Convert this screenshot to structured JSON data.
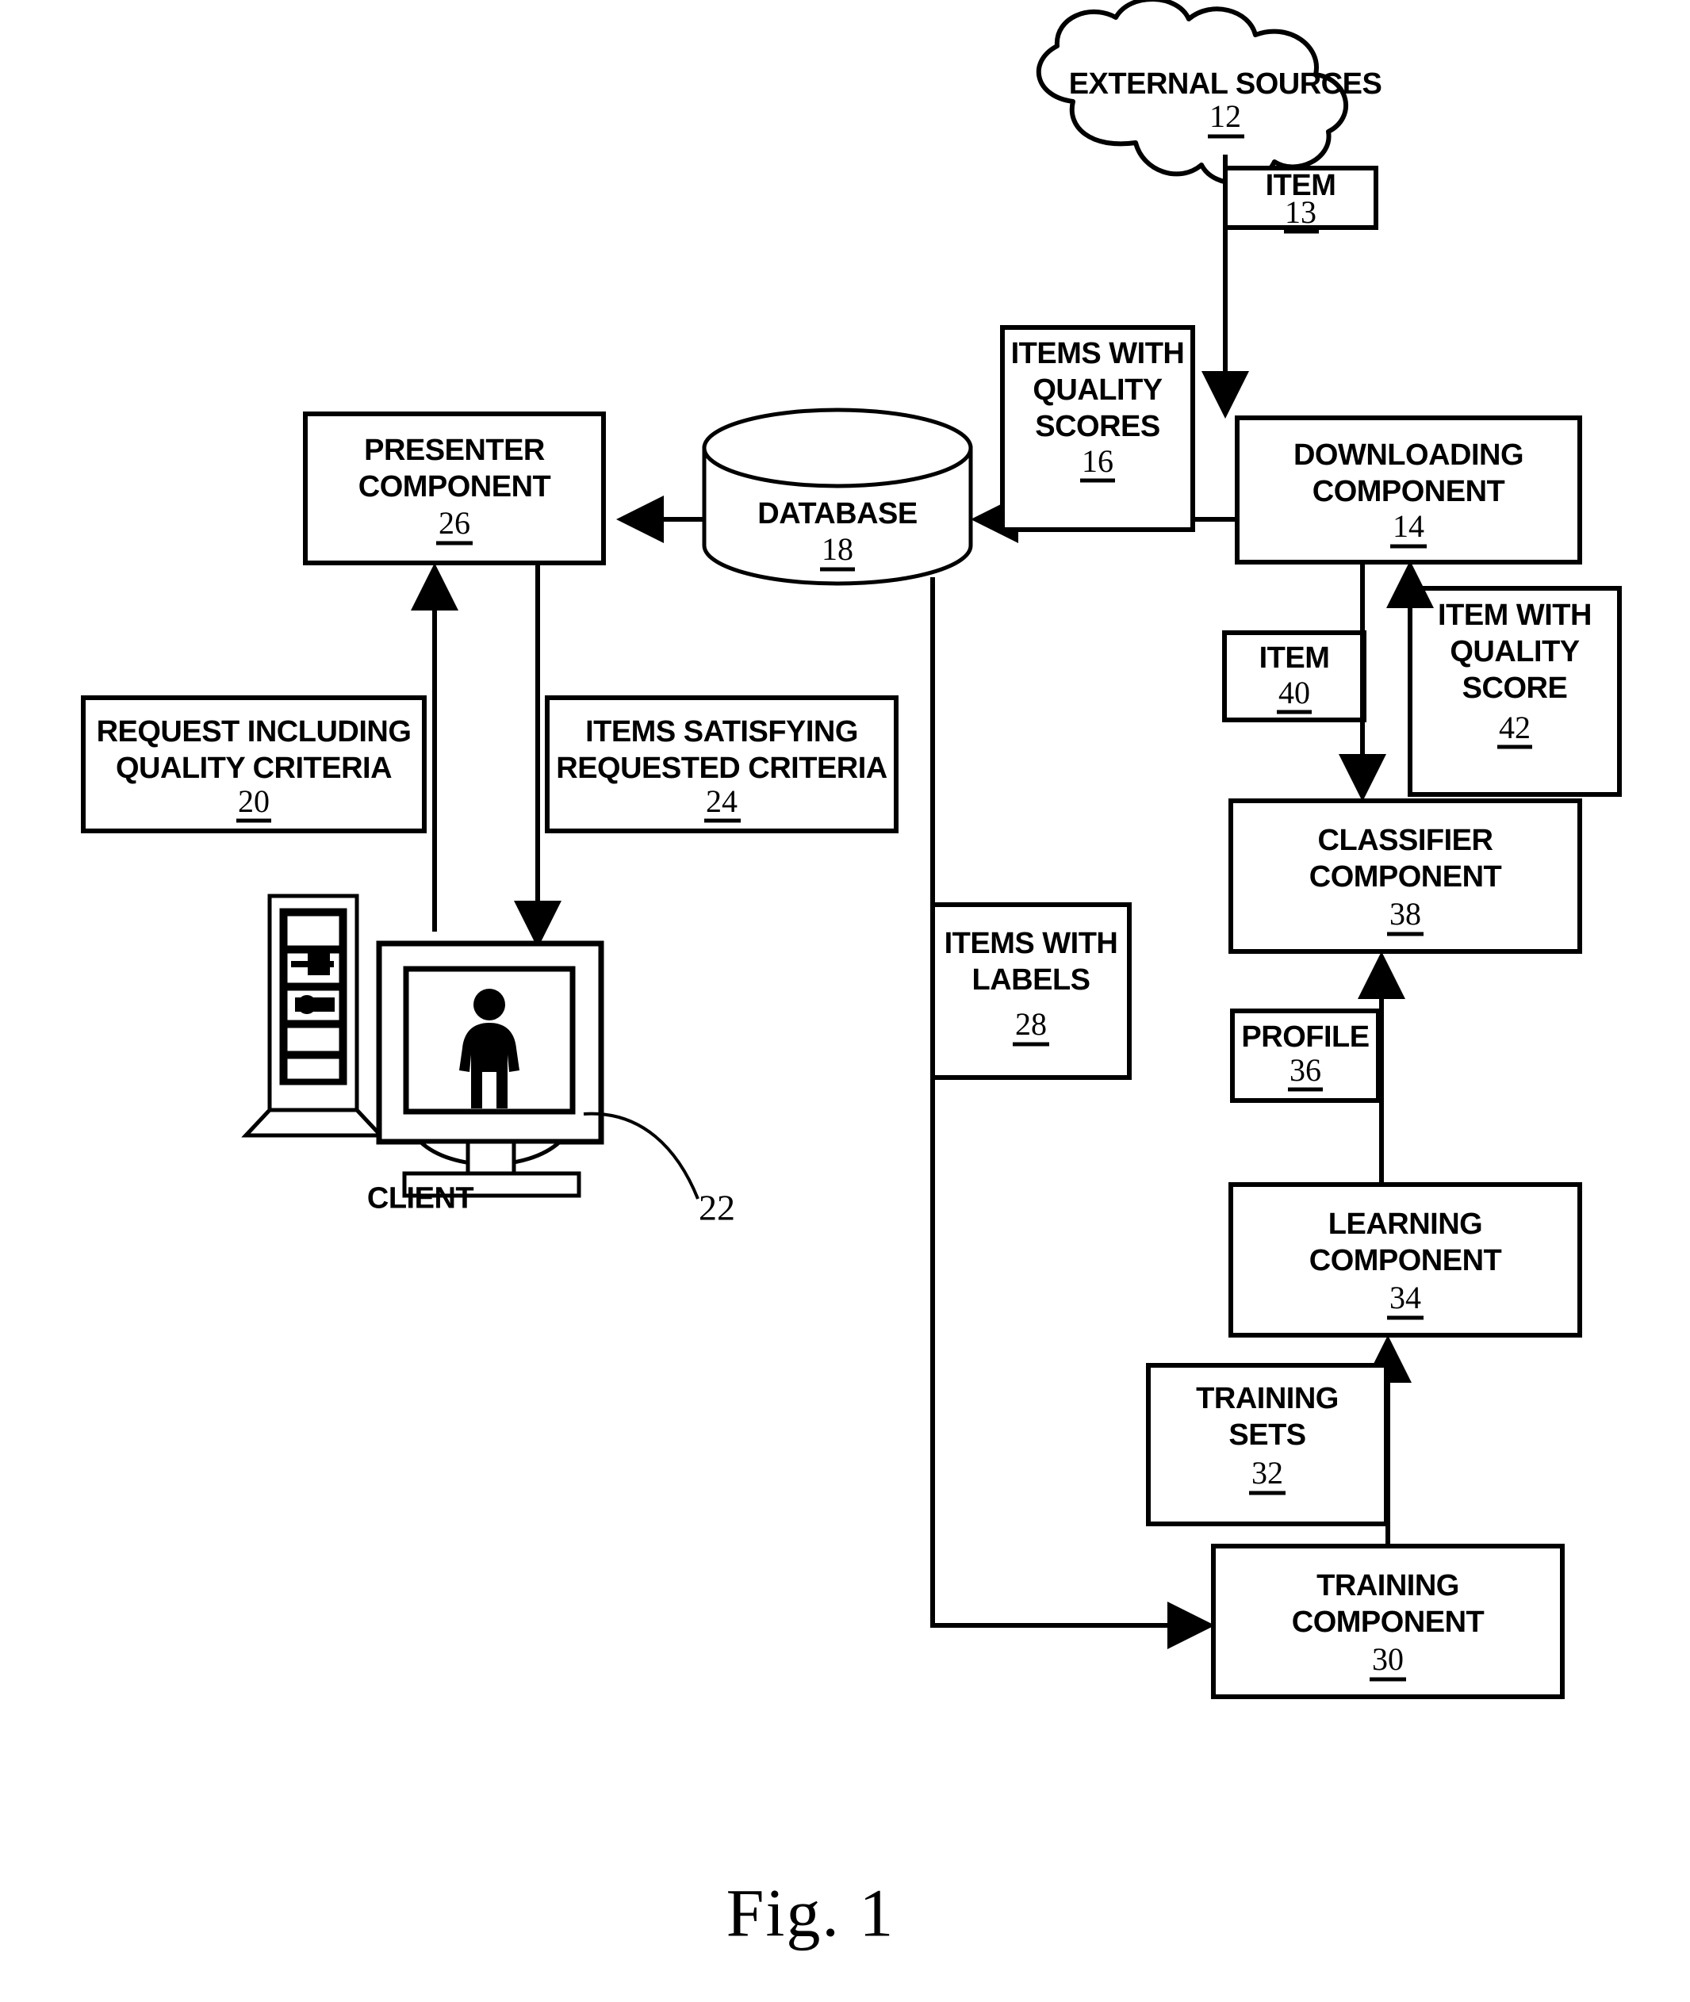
{
  "figure": {
    "caption": "Fig. 1",
    "title": "System block diagram for item quality scoring and presentation"
  },
  "nodes": {
    "external_sources": {
      "label": "EXTERNAL SOURCES",
      "ref": "12",
      "shape": "cloud"
    },
    "item_13": {
      "label": "ITEM",
      "ref": "13",
      "shape": "box"
    },
    "downloading_component": {
      "label_line1": "DOWNLOADING",
      "label_line2": "COMPONENT",
      "ref": "14",
      "shape": "box"
    },
    "items_with_quality_scores": {
      "label_line1": "ITEMS WITH",
      "label_line2": "QUALITY",
      "label_line3": "SCORES",
      "ref": "16",
      "shape": "box"
    },
    "database": {
      "label": "DATABASE",
      "ref": "18",
      "shape": "cylinder"
    },
    "presenter_component": {
      "label_line1": "PRESENTER",
      "label_line2": "COMPONENT",
      "ref": "26",
      "shape": "box"
    },
    "request_including_quality_criteria": {
      "label_line1": "REQUEST INCLUDING",
      "label_line2": "QUALITY CRITERIA",
      "ref": "20",
      "shape": "box"
    },
    "items_satisfying_requested_criteria": {
      "label_line1": "ITEMS SATISFYING",
      "label_line2": "REQUESTED CRITERIA",
      "ref": "24",
      "shape": "box"
    },
    "client": {
      "label": "CLIENT",
      "ref": "22",
      "shape": "computer"
    },
    "items_with_labels": {
      "label_line1": "ITEMS WITH",
      "label_line2": "LABELS",
      "ref": "28",
      "shape": "box"
    },
    "item_40": {
      "label": "ITEM",
      "ref": "40",
      "shape": "box"
    },
    "item_with_quality_score": {
      "label_line1": "ITEM WITH",
      "label_line2": "QUALITY",
      "label_line3": "SCORE",
      "ref": "42",
      "shape": "box"
    },
    "classifier_component": {
      "label_line1": "CLASSIFIER",
      "label_line2": "COMPONENT",
      "ref": "38",
      "shape": "box"
    },
    "profile": {
      "label": "PROFILE",
      "ref": "36",
      "shape": "box"
    },
    "learning_component": {
      "label_line1": "LEARNING",
      "label_line2": "COMPONENT",
      "ref": "34",
      "shape": "box"
    },
    "training_sets": {
      "label_line1": "TRAINING",
      "label_line2": "SETS",
      "ref": "32",
      "shape": "box"
    },
    "training_component": {
      "label_line1": "TRAINING",
      "label_line2": "COMPONENT",
      "ref": "30",
      "shape": "box"
    }
  },
  "edges": [
    {
      "from": "external_sources",
      "to": "downloading_component",
      "annotation": "item_13",
      "direction": "down"
    },
    {
      "from": "downloading_component",
      "to": "database",
      "annotation": "items_with_quality_scores",
      "direction": "left"
    },
    {
      "from": "database",
      "to": "presenter_component",
      "direction": "left"
    },
    {
      "from": "client",
      "to": "presenter_component",
      "annotation": "request_including_quality_criteria",
      "direction": "up"
    },
    {
      "from": "presenter_component",
      "to": "client",
      "annotation": "items_satisfying_requested_criteria",
      "direction": "down"
    },
    {
      "from": "database",
      "to": "training_component",
      "annotation": "items_with_labels",
      "direction": "down-right"
    },
    {
      "from": "downloading_component",
      "to": "classifier_component",
      "annotation": "item_40",
      "direction": "down"
    },
    {
      "from": "classifier_component",
      "to": "downloading_component",
      "annotation": "item_with_quality_score",
      "direction": "up"
    },
    {
      "from": "learning_component",
      "to": "classifier_component",
      "annotation": "profile",
      "direction": "up"
    },
    {
      "from": "training_component",
      "to": "learning_component",
      "annotation": "training_sets",
      "direction": "up"
    }
  ]
}
